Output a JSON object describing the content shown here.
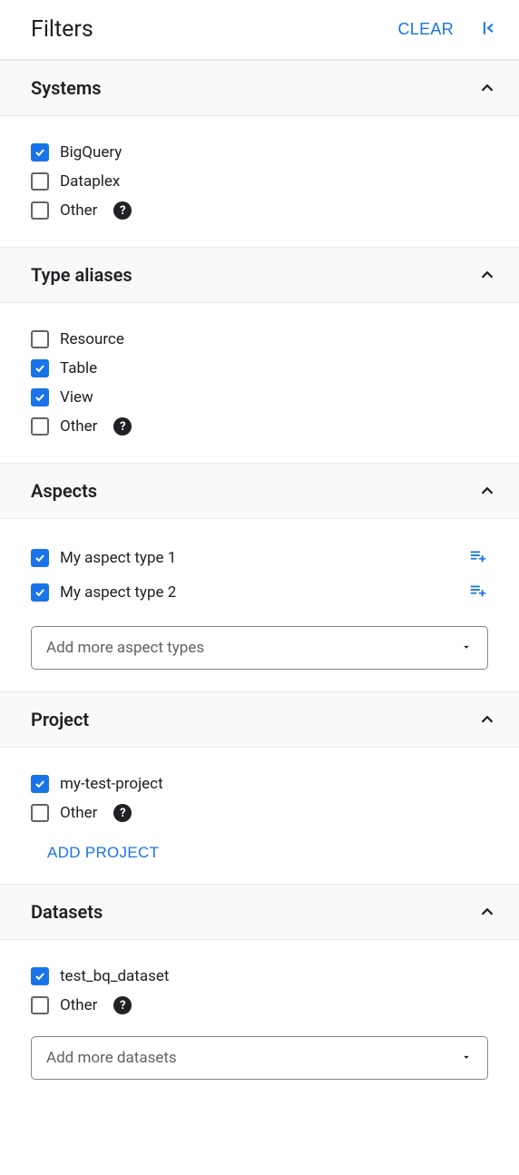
{
  "header": {
    "title": "Filters",
    "clear_label": "CLEAR"
  },
  "sections": {
    "systems": {
      "title": "Systems",
      "items": [
        {
          "label": "BigQuery",
          "checked": true,
          "help": false
        },
        {
          "label": "Dataplex",
          "checked": false,
          "help": false
        },
        {
          "label": "Other",
          "checked": false,
          "help": true
        }
      ]
    },
    "type_aliases": {
      "title": "Type aliases",
      "items": [
        {
          "label": "Resource",
          "checked": false,
          "help": false
        },
        {
          "label": "Table",
          "checked": true,
          "help": false
        },
        {
          "label": "View",
          "checked": true,
          "help": false
        },
        {
          "label": "Other",
          "checked": false,
          "help": true
        }
      ]
    },
    "aspects": {
      "title": "Aspects",
      "items": [
        {
          "label": "My aspect type 1",
          "checked": true
        },
        {
          "label": "My aspect type 2",
          "checked": true
        }
      ],
      "dropdown_placeholder": "Add more aspect types"
    },
    "project": {
      "title": "Project",
      "items": [
        {
          "label": "my-test-project",
          "checked": true,
          "help": false
        },
        {
          "label": "Other",
          "checked": false,
          "help": true
        }
      ],
      "add_button_label": "ADD PROJECT"
    },
    "datasets": {
      "title": "Datasets",
      "items": [
        {
          "label": "test_bq_dataset",
          "checked": true,
          "help": false
        },
        {
          "label": "Other",
          "checked": false,
          "help": true
        }
      ],
      "dropdown_placeholder": "Add more datasets"
    }
  }
}
